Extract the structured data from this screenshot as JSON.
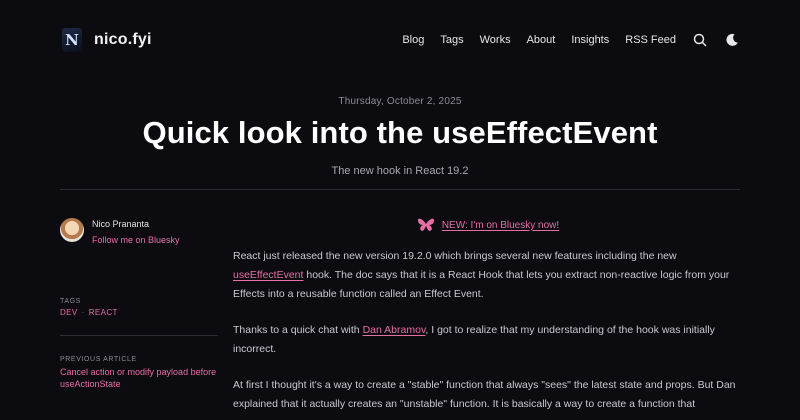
{
  "site": {
    "logo_letter": "N",
    "name": "nico.fyi"
  },
  "nav": {
    "items": [
      "Blog",
      "Tags",
      "Works",
      "About",
      "Insights",
      "RSS Feed"
    ],
    "search_icon": "search-icon",
    "theme_icon": "moon-icon"
  },
  "post": {
    "date": "Thursday, October 2, 2025",
    "title": "Quick look into the useEffectEvent",
    "subtitle": "The new hook in React 19.2"
  },
  "sidebar": {
    "author_name": "Nico Prananta",
    "author_link": "Follow me on Bluesky",
    "tags_label": "TAGS",
    "tags": [
      "DEV",
      "REACT"
    ],
    "prev_label": "PREVIOUS ARTICLE",
    "prev_title": "Cancel action or modify payload before useActionState"
  },
  "article": {
    "promo": "NEW: I'm on Bluesky now!",
    "p1_a": "React just released the new version 19.2.0 which brings several new features including the new ",
    "p1_link": "useEffectEvent",
    "p1_b": " hook. The doc says that it is a React Hook that lets you extract non-reactive logic from your Effects into a reusable function called an Effect Event.",
    "p2_a": "Thanks to a quick chat with ",
    "p2_link": "Dan Abramov",
    "p2_b": ", I got to realize that my understanding of the hook was initially incorrect.",
    "p3": "At first I thought it's a way to create a \"stable\" function that always \"sees\" the latest state and props. But Dan explained that it actually creates an \"unstable\" function. It is basically a way to create a function that"
  },
  "colors": {
    "accent": "#e76fa6",
    "background": "#0b0b10"
  }
}
